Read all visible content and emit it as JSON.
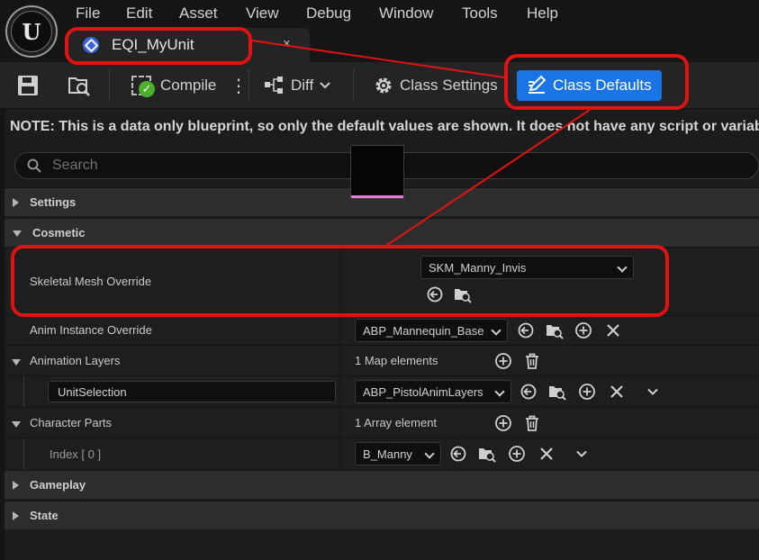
{
  "menubar": {
    "logo_letter": "U",
    "items": [
      "File",
      "Edit",
      "Asset",
      "View",
      "Debug",
      "Window",
      "Tools",
      "Help"
    ]
  },
  "tab": {
    "title": "EQI_MyUnit",
    "close_glyph": "×",
    "icon": "blueprint-icon"
  },
  "toolbar": {
    "compile_label": "Compile",
    "more_glyph": "⋮",
    "diff_label": "Diff",
    "class_settings_label": "Class Settings",
    "class_defaults_label": "Class Defaults"
  },
  "details": {
    "note": "NOTE: This is a data only blueprint, so only the default values are shown.  It does not have any script or variables.",
    "search_placeholder": "Search",
    "categories": {
      "settings": "Settings",
      "cosmetic": "Cosmetic",
      "gameplay": "Gameplay",
      "state": "State"
    },
    "skeletal_mesh": {
      "label": "Skeletal Mesh Override",
      "value": "SKM_Manny_Invis"
    },
    "anim_instance": {
      "label": "Anim Instance Override",
      "value": "ABP_Mannequin_Base"
    },
    "animation_layers": {
      "label": "Animation Layers",
      "count_text": "1 Map elements",
      "key": "UnitSelection",
      "value": "ABP_PistolAnimLayers"
    },
    "character_parts": {
      "label": "Character Parts",
      "count_text": "1 Array element",
      "index_label": "Index [ 0 ]",
      "value": "B_Manny"
    }
  },
  "colors": {
    "accent": "#1a74e6",
    "annotation": "#e01212",
    "compile_ok": "#4caf2a"
  }
}
